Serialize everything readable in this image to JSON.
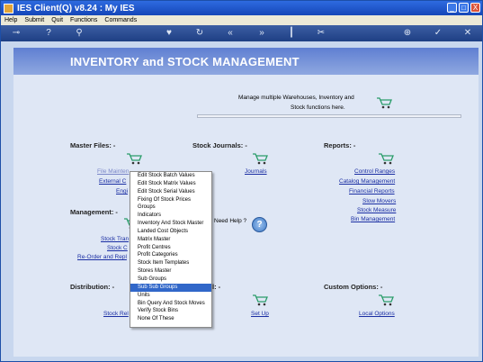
{
  "window": {
    "title": "IES Client(Q) v8.24 : My IES",
    "controls": [
      "_",
      "□",
      "X"
    ]
  },
  "menubar": [
    "Help",
    "Submit",
    "Quit",
    "Functions",
    "Commands"
  ],
  "page": {
    "title": "INVENTORY and STOCK MANAGEMENT",
    "intro_line1": "Manage multiple Warehouses, Inventory and",
    "intro_line2": "Stock functions here."
  },
  "sections": {
    "master_files": "Master Files: -",
    "stock_journals": "Stock Journals: -",
    "reports": "Reports: -",
    "management": "Management: -",
    "distribution": "Distribution: -",
    "distribution_right": "l: -",
    "custom_options": "Custom Options: -"
  },
  "links": {
    "file_maintenance": "File Mainten",
    "external": "External C",
    "engine": "Engi",
    "stock_tran": "Stock Tran",
    "stock_c": "Stock C",
    "reorder": "Re-Order and Repl",
    "stock_rel": "Stock Rel",
    "journals": "Journals",
    "set_up": "Set Up",
    "control_ranges": "Control Ranges",
    "catalog_management": "Catalog Management",
    "financial_reports": "Financial Reports",
    "slow_movers": "Slow Movers",
    "stock_measure": "Stock Measure",
    "bin_management": "Bin Management",
    "local_options": "Local Options"
  },
  "help_label": "Need Help ?",
  "dropdown": {
    "selected_index": 14,
    "items": [
      "Edit Stock Batch Values",
      "Edit Stock Matrix Values",
      "Edit Stock Serial Values",
      "Fixing Of Stock Prices",
      "Groups",
      "Indicators",
      "Inventory And Stock Master",
      "Landed Cost Objects",
      "Matrix Master",
      "Profit Centres",
      "Profit Categories",
      "Stock Item Templates",
      "Stores Master",
      "Sub Groups",
      "Sub Sub Groups",
      "Units",
      "Bin Query And Stock Moves",
      "Verify Stock Bins",
      "None Of These"
    ]
  },
  "colors": {
    "accent": "#3167c9",
    "link": "#1a2ea3",
    "header": "#6a88d6"
  }
}
